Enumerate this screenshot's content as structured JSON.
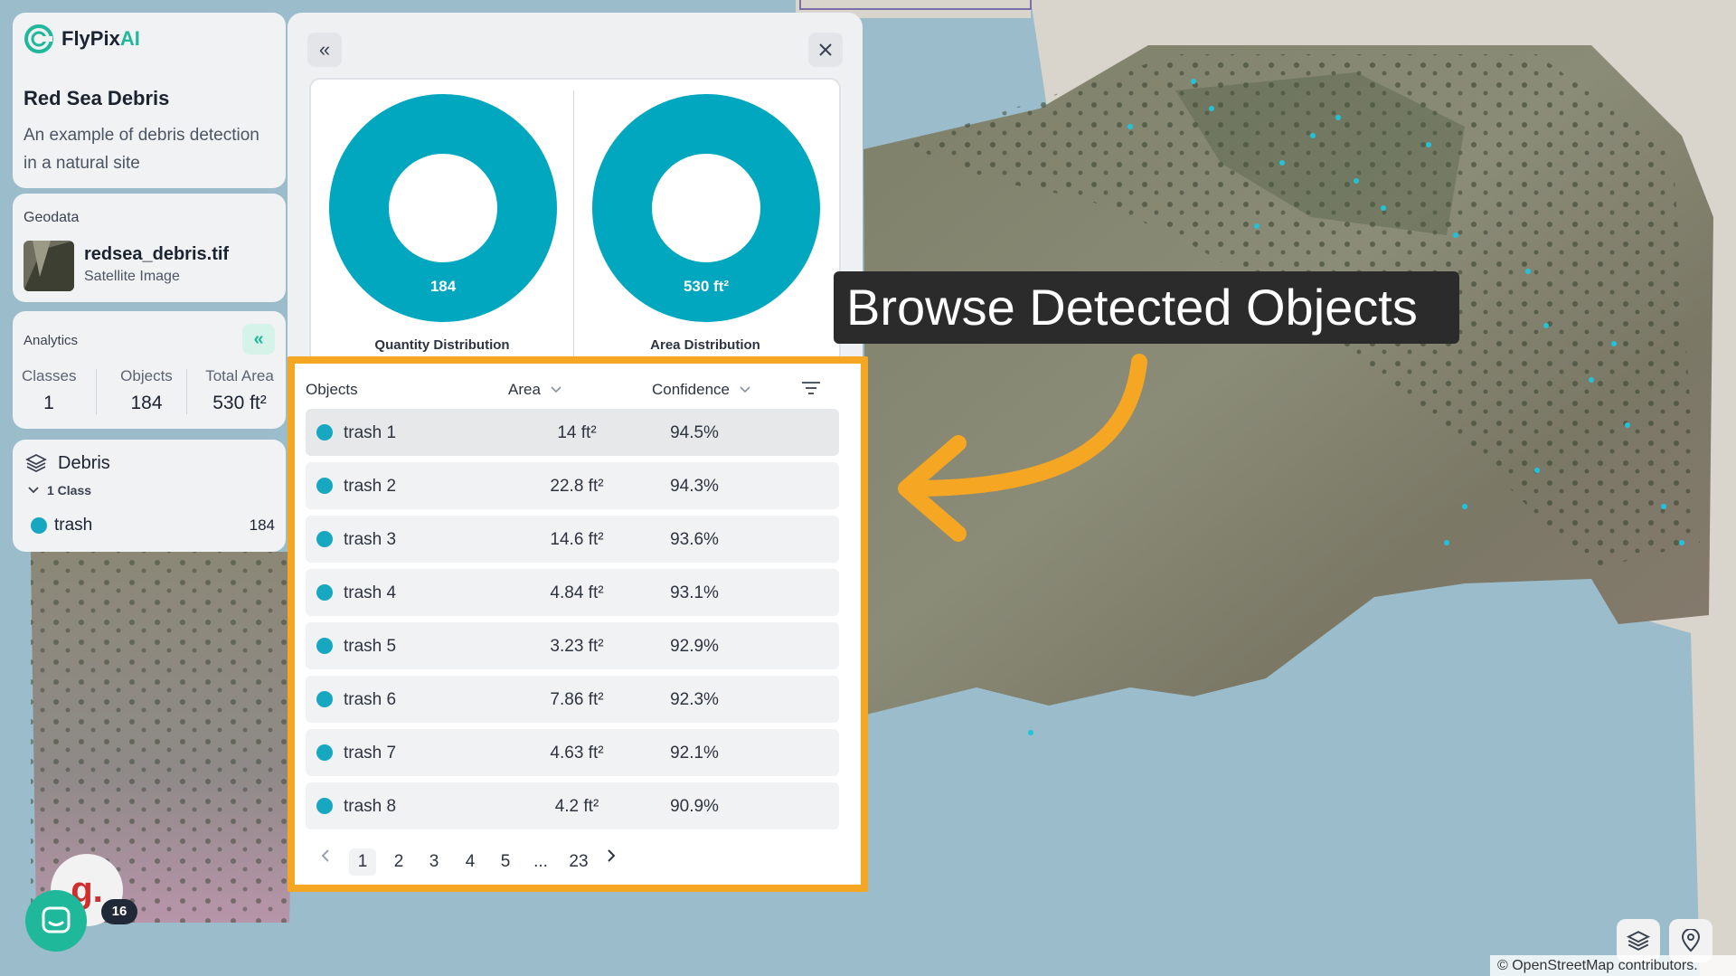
{
  "brand": {
    "name_main": "FlyPix",
    "name_accent": "AI"
  },
  "project": {
    "title": "Red Sea Debris",
    "description": "An example of debris detection in a natural site"
  },
  "geodata": {
    "section_label": "Geodata",
    "file_name": "redsea_debris.tif",
    "file_type": "Satellite Image"
  },
  "analytics": {
    "section_label": "Analytics",
    "collapse_icon": "chevrons-left-icon",
    "stats": [
      {
        "label": "Classes",
        "value": "1"
      },
      {
        "label": "Objects",
        "value": "184"
      },
      {
        "label": "Total Area",
        "value": "530 ft²"
      }
    ]
  },
  "classes": {
    "layer_name": "Debris",
    "class_count": "1 Class",
    "items": [
      {
        "name": "trash",
        "count": "184",
        "color": "#18a7c0"
      }
    ]
  },
  "charts": {
    "quantity": {
      "value": "184",
      "label": "Quantity Distribution"
    },
    "area": {
      "value": "530 ft²",
      "label": "Area Distribution"
    },
    "color": "#00a7bf"
  },
  "table": {
    "headers": {
      "objects": "Objects",
      "area": "Area",
      "confidence": "Confidence"
    },
    "rows": [
      {
        "name": "trash 1",
        "area": "14 ft²",
        "confidence": "94.5%"
      },
      {
        "name": "trash 2",
        "area": "22.8 ft²",
        "confidence": "94.3%"
      },
      {
        "name": "trash 3",
        "area": "14.6 ft²",
        "confidence": "93.6%"
      },
      {
        "name": "trash 4",
        "area": "4.84 ft²",
        "confidence": "93.1%"
      },
      {
        "name": "trash 5",
        "area": "3.23 ft²",
        "confidence": "92.9%"
      },
      {
        "name": "trash 6",
        "area": "7.86 ft²",
        "confidence": "92.3%"
      },
      {
        "name": "trash 7",
        "area": "4.63 ft²",
        "confidence": "92.1%"
      },
      {
        "name": "trash 8",
        "area": "4.2 ft²",
        "confidence": "90.9%"
      }
    ],
    "pagination": {
      "pages": [
        "1",
        "2",
        "3",
        "4",
        "5"
      ],
      "ellipsis": "...",
      "last": "23",
      "current": "1"
    }
  },
  "annotation": {
    "callout": "Browse Detected Objects",
    "highlight_color": "#f5a623"
  },
  "widgets": {
    "g_label": "g.",
    "notification_count": "16"
  },
  "map": {
    "attribution": "© OpenStreetMap contributors."
  }
}
